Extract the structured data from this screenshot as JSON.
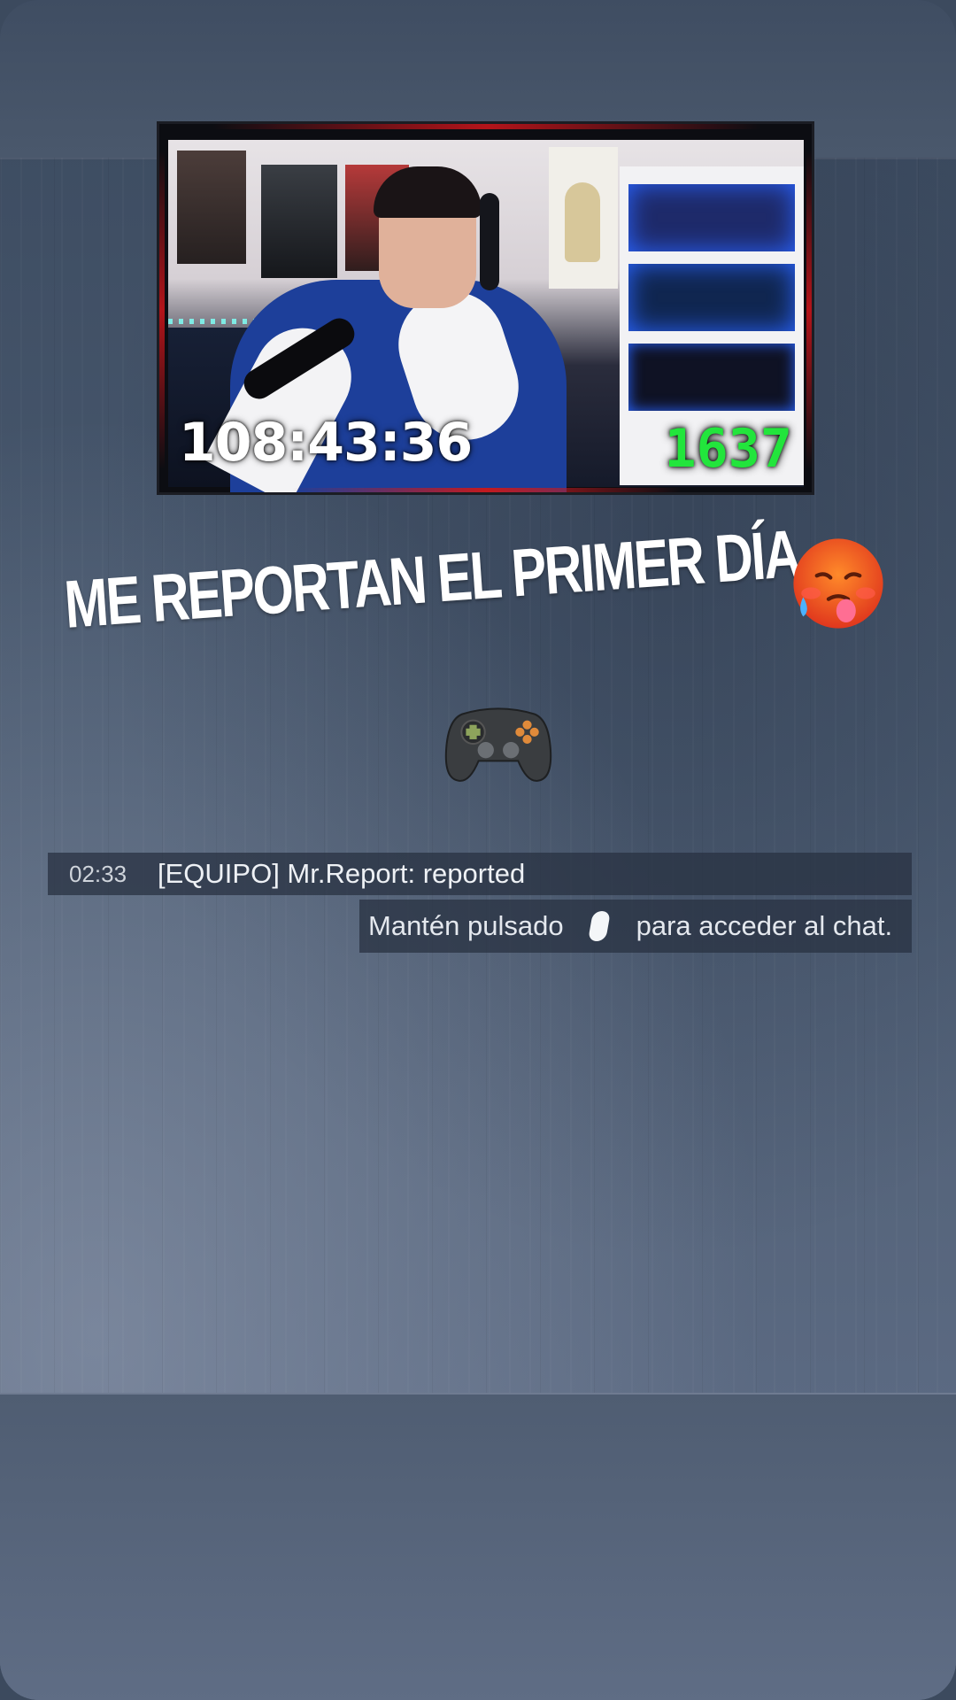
{
  "video": {
    "timer": "108:43:36",
    "counter": "1637"
  },
  "caption": {
    "text": "ME REPORTAN EL PRIMER DÍA",
    "emoji_face": "hot-face-emoji",
    "emoji_pad": "video-game-controller-emoji"
  },
  "chat": {
    "time": "02:33",
    "message": "[EQUIPO] Mr.Report: reported",
    "hint_before": "Mantén pulsado",
    "hint_icon": "right-stick-icon",
    "hint_after": "para acceder al chat."
  },
  "colors": {
    "background": "#4a5a70",
    "counter_green": "#22e53c",
    "chat_bar": "#283242"
  }
}
